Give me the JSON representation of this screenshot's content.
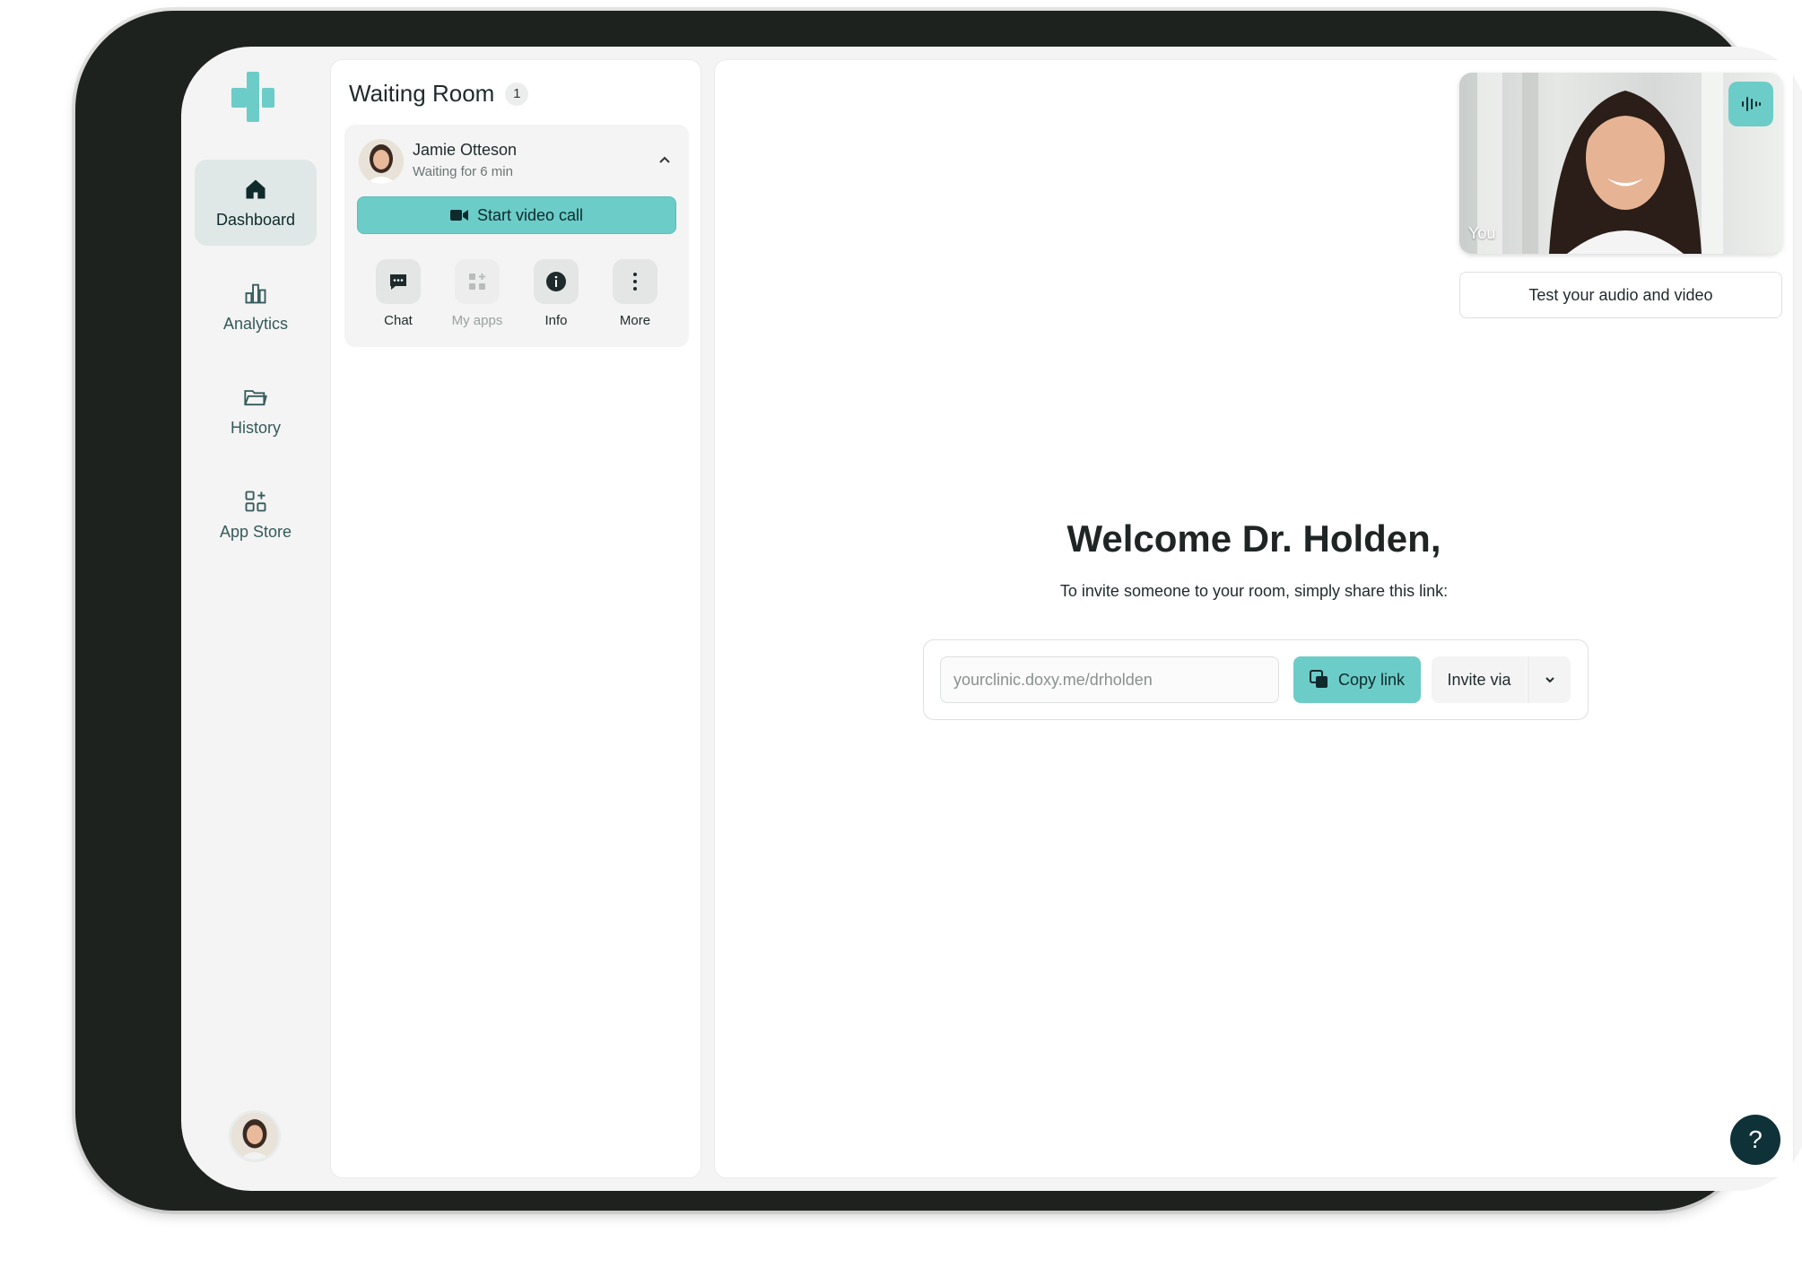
{
  "colors": {
    "accent": "#6cccc8",
    "dark": "#0f3238",
    "frame": "#1e221f"
  },
  "nav": {
    "items": [
      {
        "label": "Dashboard",
        "icon": "home-icon",
        "active": true
      },
      {
        "label": "Analytics",
        "icon": "bar-chart-icon",
        "active": false
      },
      {
        "label": "History",
        "icon": "folder-icon",
        "active": false
      },
      {
        "label": "App Store",
        "icon": "apps-plus-icon",
        "active": false
      }
    ]
  },
  "waiting_room": {
    "title": "Waiting Room",
    "count": "1",
    "patient": {
      "name": "Jamie Otteson",
      "status": "Waiting for 6 min",
      "start_call_label": "Start video call",
      "actions": [
        {
          "label": "Chat",
          "icon": "chat-icon",
          "disabled": false
        },
        {
          "label": "My apps",
          "icon": "apps-icon",
          "disabled": true
        },
        {
          "label": "Info",
          "icon": "info-icon",
          "disabled": false
        },
        {
          "label": "More",
          "icon": "more-vertical-icon",
          "disabled": false
        }
      ]
    }
  },
  "main": {
    "video_label": "You",
    "test_av_label": "Test your audio and video",
    "welcome": "Welcome Dr. Holden,",
    "subtext": "To invite someone to your room, simply share this link:",
    "link_value": "yourclinic.doxy.me/drholden",
    "copy_label": "Copy link",
    "invite_label": "Invite via",
    "help_label": "?"
  }
}
